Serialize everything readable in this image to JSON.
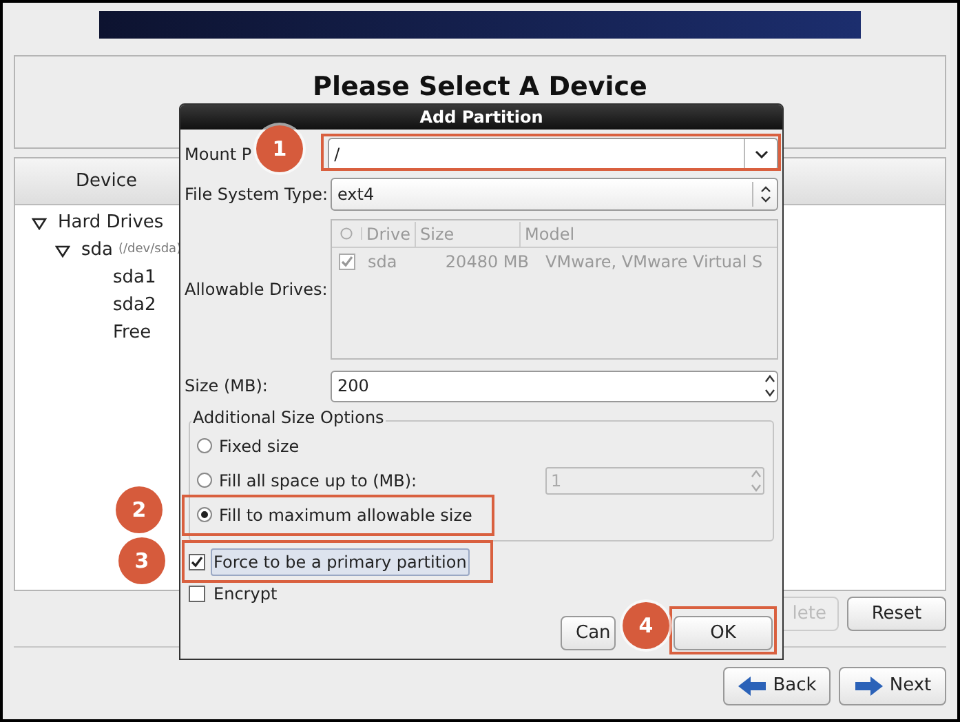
{
  "page_title": "Please Select A Device",
  "device_panel": {
    "column_header": "Device",
    "tree": [
      {
        "label": "Hard Drives",
        "expanded": true,
        "children": [
          {
            "label": "sda",
            "detail": "(/dev/sda)",
            "expanded": true,
            "children": [
              {
                "label": "sda1"
              },
              {
                "label": "sda2"
              },
              {
                "label": "Free"
              }
            ]
          }
        ]
      }
    ]
  },
  "panel_buttons": [
    {
      "label": "lete",
      "disabled": true
    },
    {
      "label": "Reset",
      "disabled": false
    }
  ],
  "nav_buttons": [
    {
      "label": "Back",
      "kind": "back"
    },
    {
      "label": "Next",
      "kind": "next"
    }
  ],
  "dialog": {
    "title": "Add Partition",
    "mount_point": {
      "label": "Mount P",
      "value": "/"
    },
    "fs_type": {
      "label": "File System Type:",
      "value": "ext4"
    },
    "drives": {
      "label": "Allowable Drives:",
      "columns": [
        "Drive",
        "Size",
        "Model"
      ],
      "rows": [
        {
          "checked": true,
          "drive": "sda",
          "size": "20480 MB",
          "model": "VMware, VMware Virtual S"
        }
      ]
    },
    "size": {
      "label": "Size (MB):",
      "value": "200"
    },
    "size_options": {
      "title": "Additional Size Options",
      "options": [
        {
          "label": "Fixed size",
          "selected": false
        },
        {
          "label": "Fill all space up to (MB):",
          "selected": false,
          "spin_value": "1"
        },
        {
          "label": "Fill to maximum allowable size",
          "selected": true
        }
      ]
    },
    "checkboxes": [
      {
        "label": "Force to be a primary partition",
        "checked": true,
        "focused": true
      },
      {
        "label": "Encrypt",
        "checked": false,
        "focused": false
      }
    ],
    "buttons": [
      "Can",
      "OK"
    ]
  },
  "annotations": [
    "1",
    "2",
    "3",
    "4"
  ]
}
